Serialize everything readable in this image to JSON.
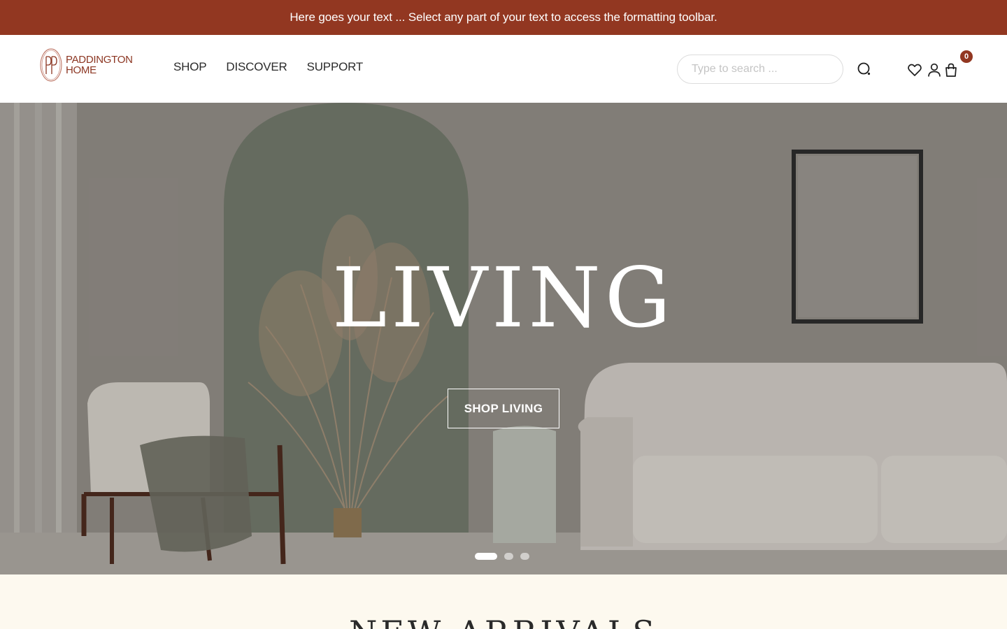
{
  "announcement": {
    "text": "Here goes your text ... Select any part of your text to access the formatting toolbar."
  },
  "brand": {
    "line1": "PADDINGTON",
    "line2": "HOME",
    "color": "#923721"
  },
  "nav": {
    "items": [
      "SHOP",
      "DISCOVER",
      "SUPPORT"
    ]
  },
  "search": {
    "placeholder": "Type to search ...",
    "value": ""
  },
  "header_icons": [
    "search-icon",
    "heart-icon",
    "user-icon",
    "bag-icon"
  ],
  "cart": {
    "count": "0"
  },
  "hero": {
    "title": "LIVING",
    "cta": "SHOP LIVING",
    "slides": 3,
    "active_slide": 1
  },
  "section": {
    "title": "NEW ARRIVALS"
  }
}
